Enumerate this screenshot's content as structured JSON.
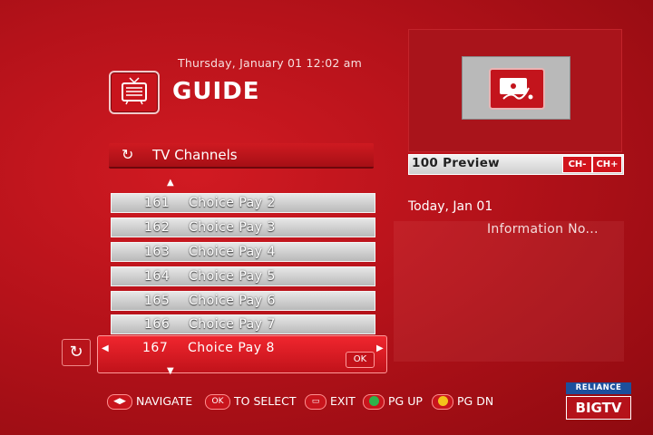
{
  "header": {
    "datetime": "Thursday, January 01 12:02 am",
    "title": "GUIDE",
    "icon": "tv-icon"
  },
  "preview": {
    "label": "100  Preview",
    "ch_minus": "CH-",
    "ch_plus": "CH+"
  },
  "info": {
    "date": "Today, Jan 01",
    "text": "Information No..."
  },
  "channels": {
    "header": "TV Channels",
    "rows": [
      {
        "num": "161",
        "name": "Choice Pay 2"
      },
      {
        "num": "162",
        "name": "Choice Pay 3"
      },
      {
        "num": "163",
        "name": "Choice Pay 4"
      },
      {
        "num": "164",
        "name": "Choice Pay 5"
      },
      {
        "num": "165",
        "name": "Choice Pay 6"
      },
      {
        "num": "166",
        "name": "Choice Pay 7"
      }
    ],
    "selected": {
      "num": "167",
      "name": "Choice Pay 8",
      "ok": "OK"
    }
  },
  "legend": {
    "navigate": "NAVIGATE",
    "ok_badge": "OK",
    "select": "TO SELECT",
    "exit": "EXIT",
    "pg_up": "PG UP",
    "pg_dn": "PG DN",
    "green": "#2fb34a",
    "yellow": "#f4c21a"
  },
  "logo": {
    "top": "RELIANCE",
    "bottom": "BIGTV"
  }
}
